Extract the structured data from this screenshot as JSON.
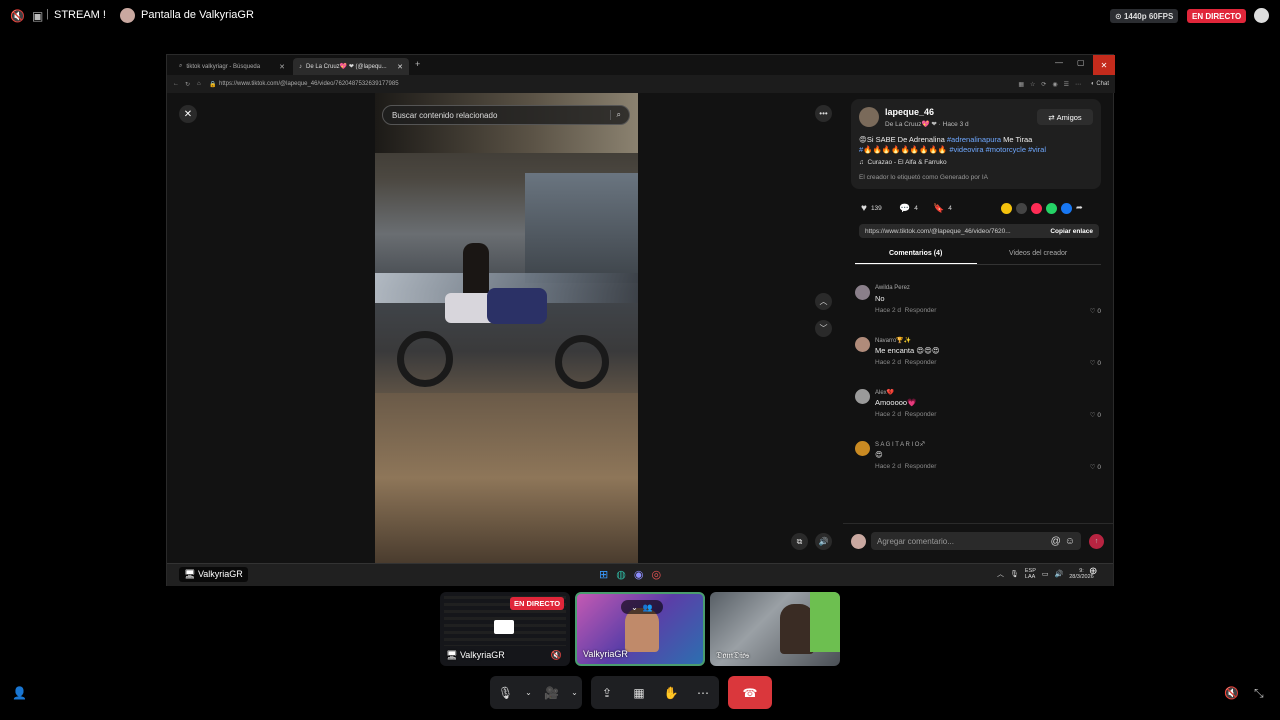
{
  "topbar": {
    "stream_channel": "STREAM !",
    "screen_title": "Pantalla de ValkyriaGR",
    "quality": "1440p 60FPS",
    "live_badge": "EN DIRECTO"
  },
  "browser": {
    "tabs": [
      {
        "label": "tiktok valkyriagr - Búsqueda"
      },
      {
        "label": "De La Cruuz💖 ❤ (@lapequ..."
      }
    ],
    "new_tab": "+",
    "url": "https://www.tiktok.com/@lapeque_46/video/7620487532639177985",
    "copilot_label": "Chat"
  },
  "tiktok": {
    "search_placeholder": "Buscar contenido relacionado",
    "author": {
      "username": "lapeque_46",
      "display": "De La Cruuz💖 ❤",
      "time": "· Hace 3 d",
      "friends_label": "Amigos"
    },
    "caption_line1": "😡Si SABE De Adrenalina ",
    "caption_tag1": "#adrenalinapura",
    "caption_mid": " Me Tiraa",
    "caption_line2_prefix": "#🔥🔥🔥🔥🔥🔥🔥🔥🔥 ",
    "caption_tags2": "#videovira #motorcycle #viral",
    "music": "Curazao - El Alfa & Farruko",
    "ai_label": "El creador lo etiquetó como Generado por IA",
    "likes": "139",
    "comments_count": "4",
    "saves": "4",
    "link": "https://www.tiktok.com/@lapeque_46/video/7620...",
    "copy_link": "Copiar enlace",
    "tab_comments": "Comentarios (4)",
    "tab_creator": "Videos del creador",
    "comments": [
      {
        "name": "Awilda Perez",
        "text": "No",
        "time": "Hace 2 d",
        "reply": "Responder",
        "likes": "0"
      },
      {
        "name": "Navarro🏆✨",
        "text": "Me encanta 😍😍😍",
        "time": "Hace 2 d",
        "reply": "Responder",
        "likes": "0"
      },
      {
        "name": "Alex💔",
        "text": "Amooooo💗",
        "time": "Hace 2 d",
        "reply": "Responder",
        "likes": "0"
      },
      {
        "name": "S A G I T A R I O♐",
        "text": "😍",
        "time": "Hace 2 d",
        "reply": "Responder",
        "likes": "0"
      }
    ],
    "add_comment_placeholder": "Agregar comentario..."
  },
  "windows_taskbar": {
    "lang": "ESP\nLAA",
    "time": "9:",
    "date": "28/3/2026"
  },
  "screen_owner_label": "ValkyriaGR",
  "participants": [
    {
      "name": "ValkyriaGR",
      "live": "EN DIRECTO"
    },
    {
      "name": "ValkyriaGR"
    },
    {
      "name": "𝔇𝔬𝔪𝔇𝔦𝔬𝔰"
    }
  ],
  "colors": {
    "live_red": "#e0263a",
    "tiktok_pink": "#fe2c55",
    "hashtag_blue": "#6fa8ff",
    "end_call_red": "#da373c"
  }
}
